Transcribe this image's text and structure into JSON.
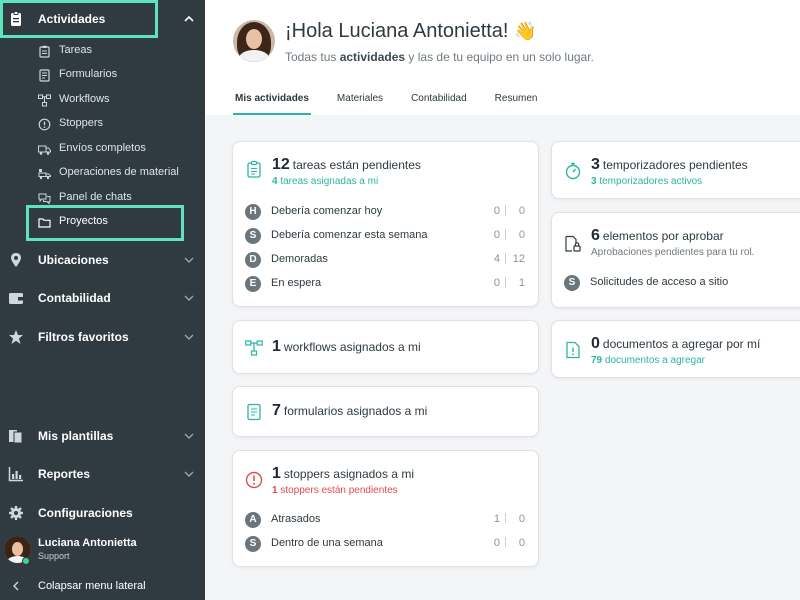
{
  "sidebar": {
    "sections": {
      "actividades": "Actividades",
      "ubicaciones": "Ubicaciones",
      "contabilidad": "Contabilidad",
      "filtros": "Filtros favoritos",
      "plantillas": "Mis plantillas",
      "reportes": "Reportes",
      "configuraciones": "Configuraciones"
    },
    "sub_items": [
      {
        "label": "Tareas",
        "icon": "clipboard-icon"
      },
      {
        "label": "Formularios",
        "icon": "form-icon"
      },
      {
        "label": "Workflows",
        "icon": "workflow-icon"
      },
      {
        "label": "Stoppers",
        "icon": "alert-circle-icon"
      },
      {
        "label": "Envíos completos",
        "icon": "truck-icon"
      },
      {
        "label": "Operaciones de material",
        "icon": "truck-loading-icon"
      },
      {
        "label": "Panel de chats",
        "icon": "chat-icon"
      },
      {
        "label": "Proyectos",
        "icon": "folder-icon"
      }
    ],
    "user": {
      "name": "Luciana Antonietta",
      "role": "Support"
    },
    "collapse_label": "Colapsar menu lateral"
  },
  "header": {
    "greeting": "¡Hola Luciana Antonietta!",
    "wave": "👋",
    "subtitle_before": "Todas tus ",
    "subtitle_bold": "actividades",
    "subtitle_after": " y las de tu equipo en un solo lugar."
  },
  "tabs": [
    "Mis actividades",
    "Materiales",
    "Contabilidad",
    "Resumen"
  ],
  "cards": {
    "tareas": {
      "count": "12",
      "title": "tareas están pendientes",
      "sub_count": "4",
      "sub_text": "tareas asignadas a mi",
      "rows": [
        {
          "letter": "H",
          "label": "Debería comenzar hoy",
          "a": "0",
          "b": "0"
        },
        {
          "letter": "S",
          "label": "Debería comenzar esta semana",
          "a": "0",
          "b": "0"
        },
        {
          "letter": "D",
          "label": "Demoradas",
          "a": "4",
          "b": "12"
        },
        {
          "letter": "E",
          "label": "En espera",
          "a": "0",
          "b": "1"
        }
      ]
    },
    "workflows": {
      "count": "1",
      "title": "workflows asignados a mi"
    },
    "formularios": {
      "count": "7",
      "title": "formularios asignados a mi"
    },
    "stoppers": {
      "count": "1",
      "title": "stoppers asignados a mi",
      "sub_count": "1",
      "sub_text": "stoppers están pendientes",
      "rows": [
        {
          "letter": "A",
          "label": "Atrasados",
          "a": "1",
          "b": "0"
        },
        {
          "letter": "S",
          "label": "Dentro de una semana",
          "a": "0",
          "b": "0"
        }
      ]
    },
    "temporizadores": {
      "count": "3",
      "title": "temporizadores pendientes",
      "sub_count": "3",
      "sub_text": "temporizadores activos"
    },
    "elementos": {
      "count": "6",
      "title": "elementos por aprobar",
      "sub_text": "Aprobaciones pendientes para tu rol.",
      "rows": [
        {
          "letter": "S",
          "label": "Solicitudes de acceso a sitio"
        }
      ]
    },
    "documentos": {
      "count": "0",
      "title": "documentos a agregar por mí",
      "sub_count": "79",
      "sub_text": "documentos a agregar"
    }
  },
  "colors": {
    "sidebar_bg": "#2f3b40",
    "highlight": "#5fe3bc",
    "accent": "#2bb5a5",
    "danger": "#e24b4b"
  }
}
